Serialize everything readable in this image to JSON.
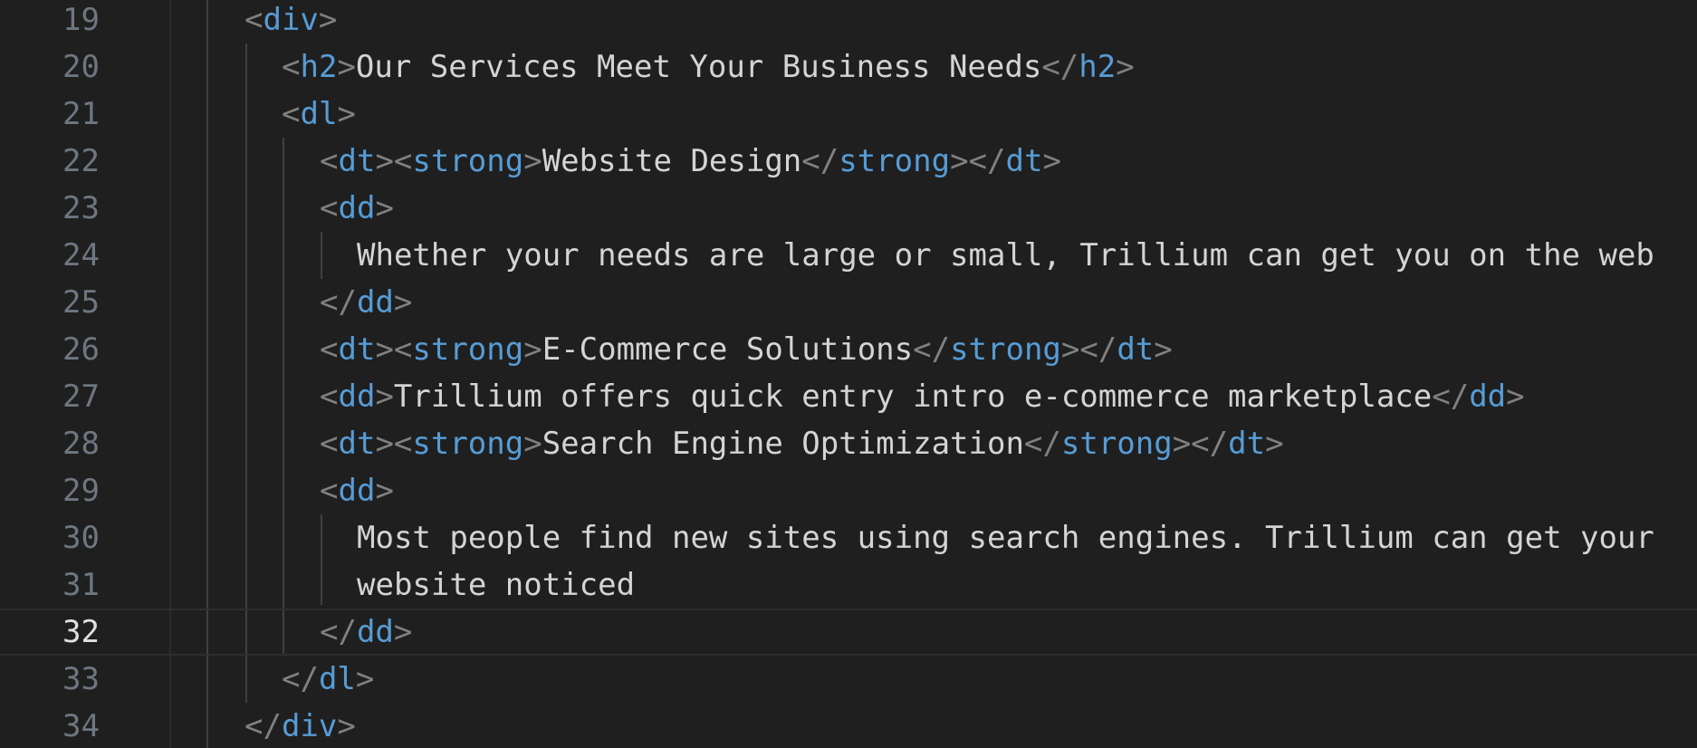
{
  "editor": {
    "lines": [
      {
        "num": "19",
        "parts": [
          {
            "k": "p",
            "v": "<"
          },
          {
            "k": "t",
            "v": "div"
          },
          {
            "k": "p",
            "v": ">"
          }
        ]
      },
      {
        "num": "20",
        "parts": [
          {
            "k": "p",
            "v": "<"
          },
          {
            "k": "t",
            "v": "h2"
          },
          {
            "k": "p",
            "v": ">"
          },
          {
            "k": "x",
            "v": "Our Services Meet Your Business Needs"
          },
          {
            "k": "p",
            "v": "</"
          },
          {
            "k": "t",
            "v": "h2"
          },
          {
            "k": "p",
            "v": ">"
          }
        ]
      },
      {
        "num": "21",
        "parts": [
          {
            "k": "p",
            "v": "<"
          },
          {
            "k": "t",
            "v": "dl"
          },
          {
            "k": "p",
            "v": ">"
          }
        ]
      },
      {
        "num": "22",
        "parts": [
          {
            "k": "p",
            "v": "<"
          },
          {
            "k": "t",
            "v": "dt"
          },
          {
            "k": "p",
            "v": "><"
          },
          {
            "k": "t",
            "v": "strong"
          },
          {
            "k": "p",
            "v": ">"
          },
          {
            "k": "x",
            "v": "Website Design"
          },
          {
            "k": "p",
            "v": "</"
          },
          {
            "k": "t",
            "v": "strong"
          },
          {
            "k": "p",
            "v": "></"
          },
          {
            "k": "t",
            "v": "dt"
          },
          {
            "k": "p",
            "v": ">"
          }
        ]
      },
      {
        "num": "23",
        "parts": [
          {
            "k": "p",
            "v": "<"
          },
          {
            "k": "t",
            "v": "dd"
          },
          {
            "k": "p",
            "v": ">"
          }
        ]
      },
      {
        "num": "24",
        "parts": [
          {
            "k": "x",
            "v": "Whether your needs are large or small, Trillium can get you on the web"
          }
        ]
      },
      {
        "num": "25",
        "parts": [
          {
            "k": "p",
            "v": "</"
          },
          {
            "k": "t",
            "v": "dd"
          },
          {
            "k": "p",
            "v": ">"
          }
        ]
      },
      {
        "num": "26",
        "parts": [
          {
            "k": "p",
            "v": "<"
          },
          {
            "k": "t",
            "v": "dt"
          },
          {
            "k": "p",
            "v": "><"
          },
          {
            "k": "t",
            "v": "strong"
          },
          {
            "k": "p",
            "v": ">"
          },
          {
            "k": "x",
            "v": "E-Commerce Solutions"
          },
          {
            "k": "p",
            "v": "</"
          },
          {
            "k": "t",
            "v": "strong"
          },
          {
            "k": "p",
            "v": "></"
          },
          {
            "k": "t",
            "v": "dt"
          },
          {
            "k": "p",
            "v": ">"
          }
        ]
      },
      {
        "num": "27",
        "parts": [
          {
            "k": "p",
            "v": "<"
          },
          {
            "k": "t",
            "v": "dd"
          },
          {
            "k": "p",
            "v": ">"
          },
          {
            "k": "x",
            "v": "Trillium offers quick entry intro e-commerce marketplace"
          },
          {
            "k": "p",
            "v": "</"
          },
          {
            "k": "t",
            "v": "dd"
          },
          {
            "k": "p",
            "v": ">"
          }
        ]
      },
      {
        "num": "28",
        "parts": [
          {
            "k": "p",
            "v": "<"
          },
          {
            "k": "t",
            "v": "dt"
          },
          {
            "k": "p",
            "v": "><"
          },
          {
            "k": "t",
            "v": "strong"
          },
          {
            "k": "p",
            "v": ">"
          },
          {
            "k": "x",
            "v": "Search Engine Optimization"
          },
          {
            "k": "p",
            "v": "</"
          },
          {
            "k": "t",
            "v": "strong"
          },
          {
            "k": "p",
            "v": "></"
          },
          {
            "k": "t",
            "v": "dt"
          },
          {
            "k": "p",
            "v": ">"
          }
        ]
      },
      {
        "num": "29",
        "parts": [
          {
            "k": "p",
            "v": "<"
          },
          {
            "k": "t",
            "v": "dd"
          },
          {
            "k": "p",
            "v": ">"
          }
        ]
      },
      {
        "num": "30",
        "parts": [
          {
            "k": "x",
            "v": "Most people find new sites using search engines. Trillium can get your"
          }
        ]
      },
      {
        "num": "31",
        "parts": [
          {
            "k": "x",
            "v": "website noticed"
          }
        ]
      },
      {
        "num": "32",
        "current": true,
        "parts": [
          {
            "k": "p",
            "v": "</"
          },
          {
            "k": "t",
            "v": "dd"
          },
          {
            "k": "p",
            "v": ">"
          }
        ]
      },
      {
        "num": "33",
        "parts": [
          {
            "k": "p",
            "v": "</"
          },
          {
            "k": "t",
            "v": "dl"
          },
          {
            "k": "p",
            "v": ">"
          }
        ]
      },
      {
        "num": "34",
        "parts": [
          {
            "k": "p",
            "v": "</"
          },
          {
            "k": "t",
            "v": "div"
          },
          {
            "k": "p",
            "v": ">"
          }
        ]
      }
    ]
  },
  "colors": {
    "background": "#1f1f1f",
    "tag": "#569cd6",
    "punctuation": "#808080",
    "text": "#d4d4d4",
    "line_number": "#6e7681",
    "active_line_number": "#e0e0e0"
  }
}
